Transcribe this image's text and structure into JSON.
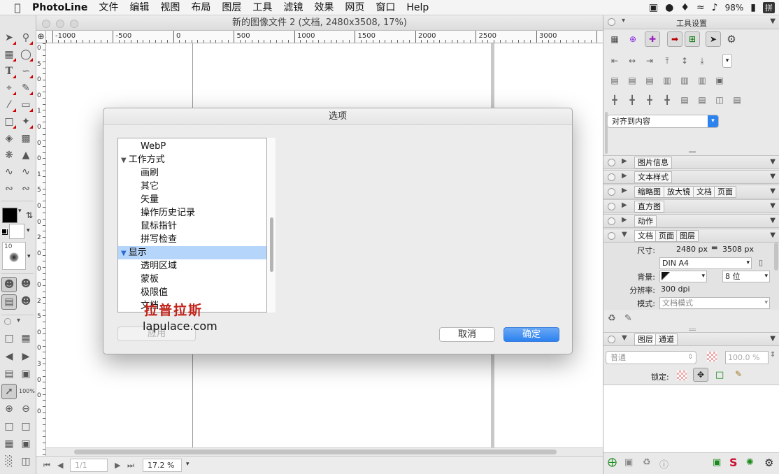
{
  "menubar": {
    "app_name": "PhotoLine",
    "items": [
      "文件",
      "编辑",
      "视图",
      "布局",
      "图层",
      "工具",
      "滤镜",
      "效果",
      "网页",
      "窗口",
      "Help"
    ],
    "battery": "98%",
    "input_method": "拼"
  },
  "document": {
    "title": "新的图像文件 2 (文档, 2480x3508, 17%)",
    "ruler_h_ticks": [
      "-1000",
      "-500",
      "0",
      "500",
      "1000",
      "1500",
      "2000",
      "2500",
      "3000"
    ],
    "ruler_v_ticks": [
      "0",
      "5",
      "0",
      "0",
      "1",
      "0",
      "0",
      "0",
      "1",
      "5",
      "0",
      "0",
      "2",
      "0",
      "0",
      "0",
      "2",
      "5",
      "0",
      "0",
      "3",
      "0",
      "0",
      "0"
    ],
    "page_field": "1/1",
    "zoom_field": "17.2 %"
  },
  "tools": {
    "zoom_label": "100%",
    "brush_size": "10"
  },
  "dialog": {
    "title": "选项",
    "list": [
      {
        "label": "WebP",
        "indent": 2,
        "type": "item"
      },
      {
        "label": "工作方式",
        "indent": 1,
        "type": "group"
      },
      {
        "label": "画刷",
        "indent": 2,
        "type": "item"
      },
      {
        "label": "其它",
        "indent": 2,
        "type": "item"
      },
      {
        "label": "矢量",
        "indent": 2,
        "type": "item"
      },
      {
        "label": "操作历史记录",
        "indent": 2,
        "type": "item"
      },
      {
        "label": "鼠标指针",
        "indent": 2,
        "type": "item"
      },
      {
        "label": "拼写检查",
        "indent": 2,
        "type": "item"
      },
      {
        "label": "显示",
        "indent": 1,
        "type": "group",
        "selected": true
      },
      {
        "label": "透明区域",
        "indent": 2,
        "type": "item"
      },
      {
        "label": "蒙板",
        "indent": 2,
        "type": "item"
      },
      {
        "label": "极限值",
        "indent": 2,
        "type": "item"
      },
      {
        "label": "文档",
        "indent": 2,
        "type": "item"
      }
    ],
    "apply_label": "应用",
    "cancel_label": "取消",
    "ok_label": "确定"
  },
  "watermark": {
    "line1": "拉普拉斯",
    "line2": "lapulace.com"
  },
  "tool_settings": {
    "title": "工具设置",
    "align_select": "对齐到内容"
  },
  "panels": {
    "image_info": "图片信息",
    "text_style": "文本样式",
    "thumb_tabs": [
      "缩略图",
      "放大镜",
      "文档",
      "页面"
    ],
    "histogram": "直方图",
    "actions": "动作",
    "doc_tabs": [
      "文档",
      "页面",
      "图层"
    ],
    "layer_tabs": [
      "图层",
      "通道"
    ]
  },
  "doc_props": {
    "size_label": "尺寸:",
    "width": "2480 px",
    "height": "3508 px",
    "paper": "DIN A4",
    "bg_label": "背景:",
    "bits": "8 位",
    "res_label": "分辨率:",
    "resolution": "300 dpi",
    "mode_label": "模式:",
    "mode": "文档模式"
  },
  "layers": {
    "blend_mode": "普通",
    "opacity": "100.0 %",
    "lock_label": "锁定:"
  },
  "colors": {
    "accent": "#2c82ef",
    "selection": "#b5d5fb",
    "watermark_red": "#c0231a"
  }
}
